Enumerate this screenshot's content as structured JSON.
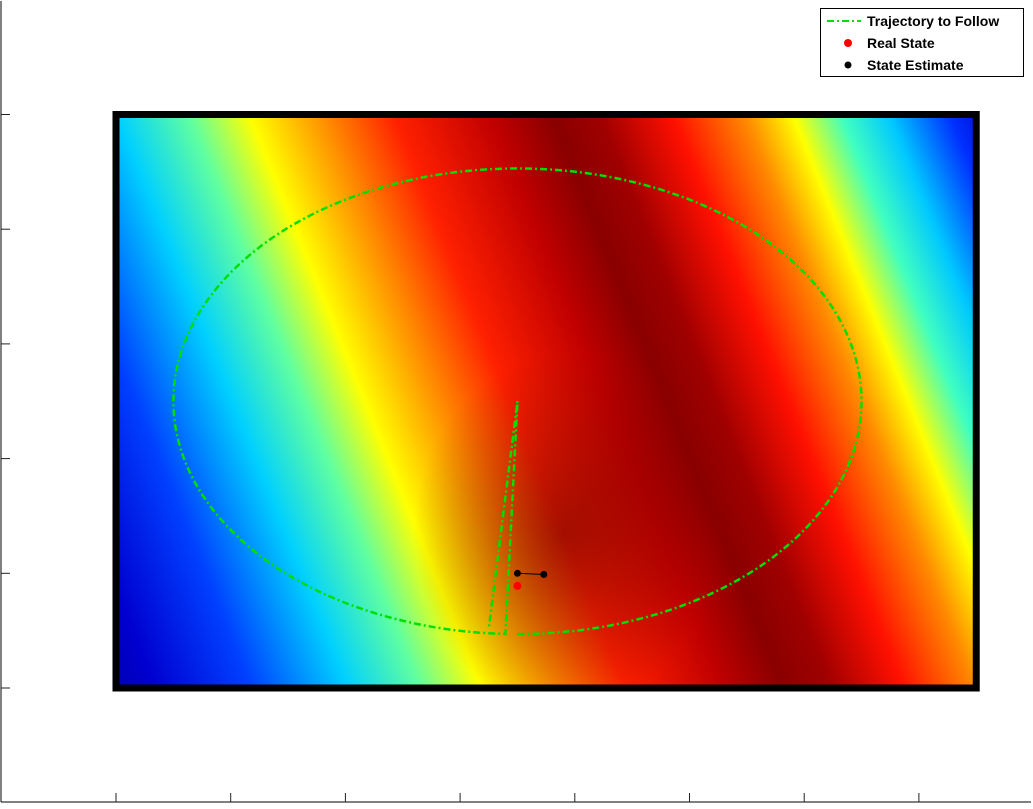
{
  "chart_data": {
    "type": "heatmap",
    "title": "",
    "xlabel": "",
    "ylabel": "",
    "xlim": [
      0,
      10
    ],
    "ylim": [
      0,
      6
    ],
    "x_ticks": [
      0,
      1,
      2,
      3,
      4,
      5,
      6,
      7,
      8
    ],
    "y_ticks": [
      0,
      1,
      2,
      3,
      4,
      5,
      6
    ],
    "x_tick_labels_visible": false,
    "y_tick_labels_visible": false,
    "field": {
      "colormap": "jet",
      "x_range": [
        0,
        7.5
      ],
      "y_range": [
        0,
        5
      ],
      "description_pattern": "diagonal bands, dark red ridge from lower-center to upper-left",
      "border_color": "#000000"
    },
    "grid": false,
    "legend_position": "top-right",
    "series": [
      {
        "name": "Trajectory to Follow",
        "style": "dash-dot",
        "color": "#00e000",
        "ellipse": {
          "cx": 3.5,
          "cy": 2.5,
          "rx": 3.0,
          "ry": 2.03,
          "start_angle_deg": -90,
          "end_angle_deg": 268
        },
        "extra_points": [
          [
            3.5,
            2.5
          ],
          [
            3.25,
            0.52
          ]
        ]
      },
      {
        "name": "Real State",
        "style": "marker",
        "color": "#ff0000",
        "points": [
          [
            3.5,
            0.89
          ]
        ]
      },
      {
        "name": "State Estimate",
        "style": "marker-line",
        "color": "#000000",
        "points": [
          [
            3.5,
            1.0
          ],
          [
            3.73,
            0.99
          ]
        ]
      }
    ]
  }
}
